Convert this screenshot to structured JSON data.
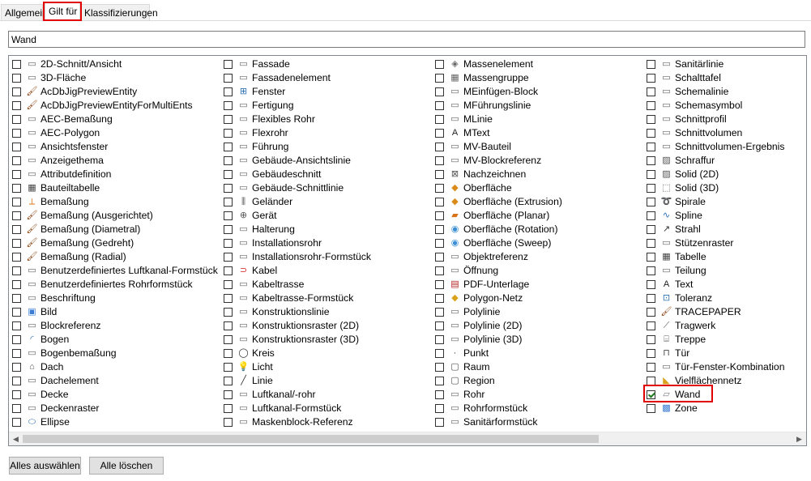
{
  "tabs": [
    {
      "label": "Allgemein",
      "active": false
    },
    {
      "label": "Gilt für",
      "active": true
    },
    {
      "label": "Klassifizierungen",
      "active": false
    }
  ],
  "filter": {
    "value": "Wand"
  },
  "columns": [
    [
      {
        "label": "2D-Schnitt/Ansicht",
        "icon": "house-section-icon",
        "checked": false
      },
      {
        "label": "3D-Fläche",
        "icon": "3d-face-icon",
        "checked": false
      },
      {
        "label": "AcDbJigPreviewEntity",
        "icon": "brush-icon",
        "checked": false
      },
      {
        "label": "AcDbJigPreviewEntityForMultiEnts",
        "icon": "brush-icon",
        "checked": false
      },
      {
        "label": "AEC-Bemaßung",
        "icon": "aec-dimension-icon",
        "checked": false
      },
      {
        "label": "AEC-Polygon",
        "icon": "polygon-icon",
        "checked": false
      },
      {
        "label": "Ansichtsfenster",
        "icon": "viewport-icon",
        "checked": false
      },
      {
        "label": "Anzeigethema",
        "icon": "display-theme-icon",
        "checked": false
      },
      {
        "label": "Attributdefinition",
        "icon": "tag-icon",
        "checked": false
      },
      {
        "label": "Bauteiltabelle",
        "icon": "table-icon",
        "checked": false
      },
      {
        "label": "Bemaßung",
        "icon": "dimension-icon",
        "checked": false
      },
      {
        "label": "Bemaßung (Ausgerichtet)",
        "icon": "brush-icon",
        "checked": false
      },
      {
        "label": "Bemaßung (Diametral)",
        "icon": "brush-icon",
        "checked": false
      },
      {
        "label": "Bemaßung (Gedreht)",
        "icon": "brush-icon",
        "checked": false
      },
      {
        "label": "Bemaßung (Radial)",
        "icon": "brush-icon",
        "checked": false
      },
      {
        "label": "Benutzerdefiniertes Luftkanal-Formstück",
        "icon": "duct-fitting-icon",
        "checked": false
      },
      {
        "label": "Benutzerdefiniertes Rohrformstück",
        "icon": "pipe-fitting-icon",
        "checked": false
      },
      {
        "label": "Beschriftung",
        "icon": "annotation-icon",
        "checked": false
      },
      {
        "label": "Bild",
        "icon": "image-icon",
        "checked": false
      },
      {
        "label": "Blockreferenz",
        "icon": "block-icon",
        "checked": false
      },
      {
        "label": "Bogen",
        "icon": "arc-icon",
        "checked": false
      },
      {
        "label": "Bogenbemaßung",
        "icon": "arc-dimension-icon",
        "checked": false
      },
      {
        "label": "Dach",
        "icon": "roof-icon",
        "checked": false
      },
      {
        "label": "Dachelement",
        "icon": "roof-slab-icon",
        "checked": false
      },
      {
        "label": "Decke",
        "icon": "slab-icon",
        "checked": false
      },
      {
        "label": "Deckenraster",
        "icon": "ceiling-grid-icon",
        "checked": false
      },
      {
        "label": "Ellipse",
        "icon": "ellipse-icon",
        "checked": false
      }
    ],
    [
      {
        "label": "Fassade",
        "icon": "curtain-wall-icon",
        "checked": false
      },
      {
        "label": "Fassadenelement",
        "icon": "curtain-wall-unit-icon",
        "checked": false
      },
      {
        "label": "Fenster",
        "icon": "window-icon",
        "checked": false
      },
      {
        "label": "Fertigung",
        "icon": "fabrication-icon",
        "checked": false
      },
      {
        "label": "Flexibles Rohr",
        "icon": "flex-pipe-icon",
        "checked": false
      },
      {
        "label": "Flexrohr",
        "icon": "flex-duct-icon",
        "checked": false
      },
      {
        "label": "Führung",
        "icon": "leader-icon",
        "checked": false
      },
      {
        "label": "Gebäude-Ansichtslinie",
        "icon": "elevation-line-icon",
        "checked": false
      },
      {
        "label": "Gebäudeschnitt",
        "icon": "building-section-icon",
        "checked": false
      },
      {
        "label": "Gebäude-Schnittlinie",
        "icon": "section-line-icon",
        "checked": false
      },
      {
        "label": "Geländer",
        "icon": "railing-icon",
        "checked": false
      },
      {
        "label": "Gerät",
        "icon": "device-icon",
        "checked": false
      },
      {
        "label": "Halterung",
        "icon": "hanger-icon",
        "checked": false
      },
      {
        "label": "Installationsrohr",
        "icon": "conduit-icon",
        "checked": false
      },
      {
        "label": "Installationsrohr-Formstück",
        "icon": "conduit-fitting-icon",
        "checked": false
      },
      {
        "label": "Kabel",
        "icon": "cable-icon",
        "checked": false
      },
      {
        "label": "Kabeltrasse",
        "icon": "cable-tray-icon",
        "checked": false
      },
      {
        "label": "Kabeltrasse-Formstück",
        "icon": "cable-tray-fitting-icon",
        "checked": false
      },
      {
        "label": "Konstruktionslinie",
        "icon": "construction-line-icon",
        "checked": false
      },
      {
        "label": "Konstruktionsraster (2D)",
        "icon": "grid-2d-icon",
        "checked": false
      },
      {
        "label": "Konstruktionsraster (3D)",
        "icon": "grid-3d-icon",
        "checked": false
      },
      {
        "label": "Kreis",
        "icon": "circle-icon",
        "checked": false
      },
      {
        "label": "Licht",
        "icon": "light-bulb-icon",
        "checked": false
      },
      {
        "label": "Linie",
        "icon": "line-icon",
        "checked": false
      },
      {
        "label": "Luftkanal/-rohr",
        "icon": "duct-icon",
        "checked": false
      },
      {
        "label": "Luftkanal-Formstück",
        "icon": "duct-fitting-icon",
        "checked": false
      },
      {
        "label": "Maskenblock-Referenz",
        "icon": "mask-block-icon",
        "checked": false
      }
    ],
    [
      {
        "label": "Massenelement",
        "icon": "mass-element-icon",
        "checked": false
      },
      {
        "label": "Massengruppe",
        "icon": "mass-group-icon",
        "checked": false
      },
      {
        "label": "MEinfügen-Block",
        "icon": "minsert-block-icon",
        "checked": false
      },
      {
        "label": "MFührungslinie",
        "icon": "mleader-icon",
        "checked": false
      },
      {
        "label": "MLinie",
        "icon": "mline-icon",
        "checked": false
      },
      {
        "label": "MText",
        "icon": "mtext-icon",
        "checked": false
      },
      {
        "label": "MV-Bauteil",
        "icon": "mv-part-icon",
        "checked": false
      },
      {
        "label": "MV-Blockreferenz",
        "icon": "mv-block-icon",
        "checked": false
      },
      {
        "label": "Nachzeichnen",
        "icon": "trace-icon",
        "checked": false
      },
      {
        "label": "Oberfläche",
        "icon": "surface-icon",
        "checked": false
      },
      {
        "label": "Oberfläche (Extrusion)",
        "icon": "surface-extrusion-icon",
        "checked": false
      },
      {
        "label": "Oberfläche (Planar)",
        "icon": "surface-planar-icon",
        "checked": false
      },
      {
        "label": "Oberfläche (Rotation)",
        "icon": "surface-revolve-icon",
        "checked": false
      },
      {
        "label": "Oberfläche (Sweep)",
        "icon": "surface-sweep-icon",
        "checked": false
      },
      {
        "label": "Objektreferenz",
        "icon": "object-reference-icon",
        "checked": false
      },
      {
        "label": "Öffnung",
        "icon": "opening-icon",
        "checked": false
      },
      {
        "label": "PDF-Unterlage",
        "icon": "pdf-icon",
        "checked": false
      },
      {
        "label": "Polygon-Netz",
        "icon": "polygon-mesh-icon",
        "checked": false
      },
      {
        "label": "Polylinie",
        "icon": "polyline-icon",
        "checked": false
      },
      {
        "label": "Polylinie (2D)",
        "icon": "polyline-2d-icon",
        "checked": false
      },
      {
        "label": "Polylinie (3D)",
        "icon": "polyline-3d-icon",
        "checked": false
      },
      {
        "label": "Punkt",
        "icon": "point-icon",
        "checked": false
      },
      {
        "label": "Raum",
        "icon": "space-icon",
        "checked": false
      },
      {
        "label": "Region",
        "icon": "region-icon",
        "checked": false
      },
      {
        "label": "Rohr",
        "icon": "pipe-icon",
        "checked": false
      },
      {
        "label": "Rohrformstück",
        "icon": "pipe-fitting-icon",
        "checked": false
      },
      {
        "label": "Sanitärformstück",
        "icon": "plumbing-fitting-icon",
        "checked": false
      }
    ],
    [
      {
        "label": "Sanitärlinie",
        "icon": "plumbing-line-icon",
        "checked": false
      },
      {
        "label": "Schalttafel",
        "icon": "panel-icon",
        "checked": false
      },
      {
        "label": "Schemalinie",
        "icon": "schematic-line-icon",
        "checked": false
      },
      {
        "label": "Schemasymbol",
        "icon": "schematic-symbol-icon",
        "checked": false
      },
      {
        "label": "Schnittprofil",
        "icon": "section-profile-icon",
        "checked": false
      },
      {
        "label": "Schnittvolumen",
        "icon": "section-volume-icon",
        "checked": false
      },
      {
        "label": "Schnittvolumen-Ergebnis",
        "icon": "section-result-icon",
        "checked": false
      },
      {
        "label": "Schraffur",
        "icon": "hatch-icon",
        "checked": false
      },
      {
        "label": "Solid (2D)",
        "icon": "solid-2d-icon",
        "checked": false
      },
      {
        "label": "Solid (3D)",
        "icon": "solid-3d-icon",
        "checked": false
      },
      {
        "label": "Spirale",
        "icon": "helix-icon",
        "checked": false
      },
      {
        "label": "Spline",
        "icon": "spline-icon",
        "checked": false
      },
      {
        "label": "Strahl",
        "icon": "ray-icon",
        "checked": false
      },
      {
        "label": "Stützenraster",
        "icon": "column-grid-icon",
        "checked": false
      },
      {
        "label": "Tabelle",
        "icon": "table-icon",
        "checked": false
      },
      {
        "label": "Teilung",
        "icon": "division-icon",
        "checked": false
      },
      {
        "label": "Text",
        "icon": "text-icon",
        "checked": false
      },
      {
        "label": "Toleranz",
        "icon": "tolerance-icon",
        "checked": false
      },
      {
        "label": "TRACEPAPER",
        "icon": "brush-icon",
        "checked": false
      },
      {
        "label": "Tragwerk",
        "icon": "structural-member-icon",
        "checked": false
      },
      {
        "label": "Treppe",
        "icon": "stair-icon",
        "checked": false
      },
      {
        "label": "Tür",
        "icon": "door-icon",
        "checked": false
      },
      {
        "label": "Tür-Fenster-Kombination",
        "icon": "door-window-assembly-icon",
        "checked": false
      },
      {
        "label": "Vielflächennetz",
        "icon": "polyface-mesh-icon",
        "checked": false
      },
      {
        "label": "Wand",
        "icon": "wall-icon",
        "checked": true
      },
      {
        "label": "Zone",
        "icon": "zone-icon",
        "checked": false
      }
    ]
  ],
  "buttons": {
    "select_all": "Alles auswählen",
    "clear_all": "Alle löschen"
  },
  "colors": {
    "highlight": "#e00000",
    "check": "#1e7c1e",
    "accent_brush": "#8b4513"
  }
}
